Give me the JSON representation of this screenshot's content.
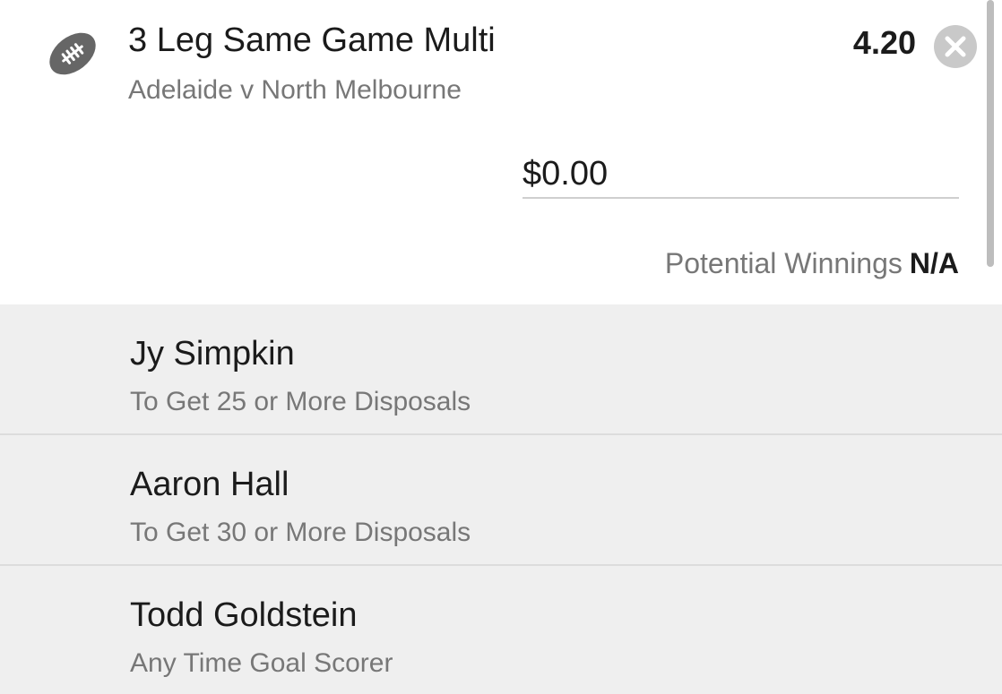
{
  "bet": {
    "sport_icon": "football-icon",
    "title": "3 Leg Same Game Multi",
    "subtitle": "Adelaide v North Melbourne",
    "odds": "4.20",
    "close_icon": "close-icon"
  },
  "stake": {
    "value": "$0.00"
  },
  "winnings": {
    "label": "Potential Winnings",
    "value": "N/A"
  },
  "legs": [
    {
      "player": "Jy Simpkin",
      "market": "To Get 25 or More Disposals"
    },
    {
      "player": "Aaron Hall",
      "market": "To Get 30 or More Disposals"
    },
    {
      "player": "Todd Goldstein",
      "market": "Any Time Goal Scorer"
    }
  ],
  "colors": {
    "header_bg": "#ffffff",
    "legs_bg": "#efefef",
    "primary_text": "#1b1b1b",
    "secondary_text": "#777777",
    "close_button": "#c9c9c9",
    "icon": "#666666"
  }
}
